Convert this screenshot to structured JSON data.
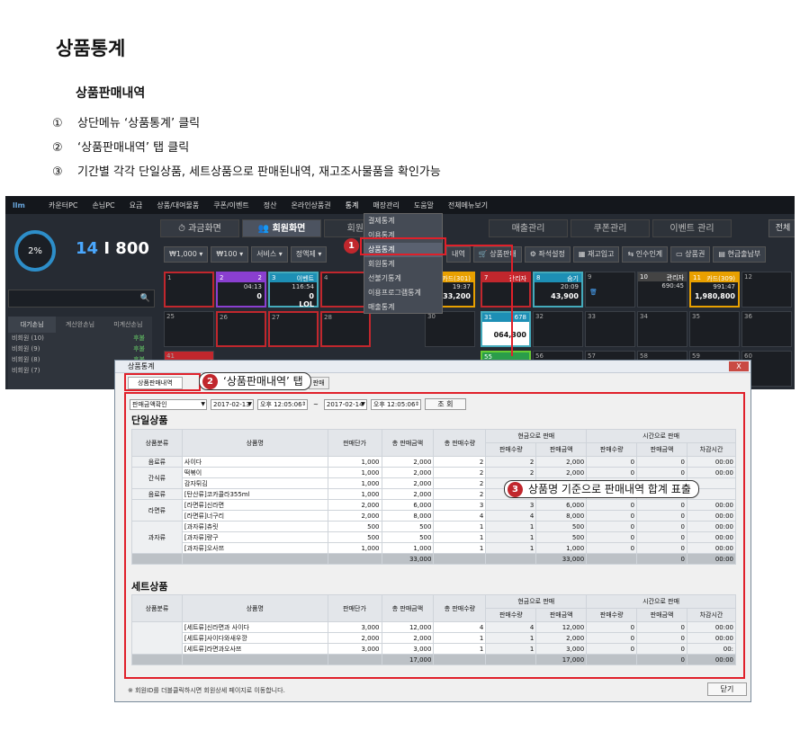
{
  "doc": {
    "title": "상품통계",
    "subtitle": "상품판매내역",
    "steps": [
      {
        "num": "①",
        "text": "상단메뉴 ‘상품통계’ 클릭"
      },
      {
        "num": "②",
        "text": "‘상품판매내역’ 탭 클릭"
      },
      {
        "num": "③",
        "text": "기간별 각각 단일상품, 세트상품으로 판매된내역, 재고조사물품을 확인가능"
      }
    ]
  },
  "app": {
    "logo": "llm",
    "menu": [
      "카운터PC",
      "손님PC",
      "요금",
      "상품/대여물품",
      "쿠폰/이벤트",
      "정산",
      "온라인상품권",
      "통계",
      "매장관리",
      "도움말",
      "전체메뉴보기"
    ],
    "gauge": "2%",
    "count_a": "14",
    "count_sep": " I ",
    "count_b": "800",
    "tabs": [
      "과금화면",
      "회원화면",
      "회원관리",
      "매출관리",
      "쿠폰관리",
      "이벤트 관리"
    ],
    "corner_label": "전체",
    "buttons_left": [
      "₩1,000",
      "₩100",
      "서비스",
      "정액제"
    ],
    "buttons_right": [
      "내역",
      "상품판매",
      "좌석설정",
      "재고입고",
      "인수인계",
      "상품권",
      "현금출납부"
    ],
    "wait_tabs": [
      "대기손님",
      "계산완손님",
      "미계산손님"
    ],
    "wait_rows": [
      {
        "name": "비회원 (10)",
        "state": "후불"
      },
      {
        "name": "비회원 (9)",
        "state": "후불"
      },
      {
        "name": "비회원 (8)",
        "state": "후불"
      },
      {
        "name": "비회원 (7)",
        "state": "후불"
      }
    ],
    "dropdown": [
      "결제통계",
      "이용통계",
      "상품통계",
      "회원통계",
      "선불기통계",
      "이용프로그램통계",
      "매출통계"
    ],
    "seats_row1": [
      {
        "no": "1",
        "name": "",
        "time": "",
        "amt": ""
      },
      {
        "no": "2",
        "name": "2",
        "time": "04:13",
        "amt": "0"
      },
      {
        "no": "3",
        "name": "이벤트",
        "time": "116:54",
        "amt": "0"
      },
      {
        "no": "4",
        "name": "",
        "time": "",
        "amt": ""
      },
      {
        "no": "6",
        "name": "카드(301)",
        "time": "19:37",
        "amt": "33,200"
      },
      {
        "no": "7",
        "name": "관리자",
        "time": "",
        "amt": ""
      },
      {
        "no": "8",
        "name": "숨기",
        "time": "20:09",
        "amt": "43,900"
      },
      {
        "no": "9",
        "name": "",
        "time": "",
        "amt": ""
      },
      {
        "no": "10",
        "name": "관리자",
        "time": "690:45",
        "amt": ""
      },
      {
        "no": "11",
        "name": "카드(309)",
        "time": "991:47",
        "amt": "1,980,800"
      },
      {
        "no": "12",
        "name": "",
        "time": "",
        "amt": ""
      }
    ],
    "seat3_extra": "LOL",
    "seats_row2": [
      "25",
      "26",
      "27",
      "28",
      "30",
      "31",
      "32",
      "33",
      "34",
      "35",
      "36"
    ],
    "seat31_amt": "064,300",
    "seat31_name": "678",
    "seats_row3": [
      "41",
      "55",
      "56",
      "57",
      "58",
      "59",
      "60"
    ]
  },
  "dialog": {
    "title": "상품통계",
    "tab_active": "상품판매내역",
    "tab_other": "판매",
    "close_x": "X",
    "filter": {
      "type": "판매금액확인",
      "date_from": "2017-02-13",
      "time_from": "오후 12:05:06",
      "tilde": "~",
      "date_to": "2017-02-14",
      "time_to": "오후 12:05:06",
      "query": "조  회"
    },
    "single": {
      "title": "단일상품",
      "headers": [
        "상품분류",
        "상품명",
        "판매단가",
        "총 판매금액",
        "총 판매수량",
        "현금으로 판매",
        "시간으로 판매"
      ],
      "subheaders": [
        "판매수량",
        "판매금액",
        "판매수량",
        "판매금액",
        "차감시간"
      ],
      "rows": [
        {
          "cat": "음료류",
          "name": "사이다",
          "price": "1,000",
          "total": "2,000",
          "qty": "2",
          "cq": "2",
          "ca": "2,000",
          "tq": "0",
          "ta": "0",
          "tt": "00:00"
        },
        {
          "cat": "간식류",
          "name": "떡볶이",
          "price": "1,000",
          "total": "2,000",
          "qty": "2",
          "cq": "2",
          "ca": "2,000",
          "tq": "0",
          "ta": "0",
          "tt": "00:00"
        },
        {
          "cat": "",
          "name": "감자튀김",
          "price": "1,000",
          "total": "2,000",
          "qty": "2",
          "cq": "",
          "ca": "",
          "tq": "",
          "ta": "",
          "tt": ""
        },
        {
          "cat": "음료류",
          "name": "[탄산류]코카콜라355ml",
          "price": "1,000",
          "total": "2,000",
          "qty": "2",
          "cq": "",
          "ca": "",
          "tq": "",
          "ta": "",
          "tt": ""
        },
        {
          "cat": "라면류",
          "name": "[라면류]신라면",
          "price": "2,000",
          "total": "6,000",
          "qty": "3",
          "cq": "3",
          "ca": "6,000",
          "tq": "0",
          "ta": "0",
          "tt": "00:00"
        },
        {
          "cat": "",
          "name": "[라면류]너구리",
          "price": "2,000",
          "total": "8,000",
          "qty": "4",
          "cq": "4",
          "ca": "8,000",
          "tq": "0",
          "ta": "0",
          "tt": "00:00"
        },
        {
          "cat": "과자류",
          "name": "[과자류]츄릿",
          "price": "500",
          "total": "500",
          "qty": "1",
          "cq": "1",
          "ca": "500",
          "tq": "0",
          "ta": "0",
          "tt": "00:00"
        },
        {
          "cat": "",
          "name": "[과자류]량구",
          "price": "500",
          "total": "500",
          "qty": "1",
          "cq": "1",
          "ca": "500",
          "tq": "0",
          "ta": "0",
          "tt": "00:00"
        },
        {
          "cat": "",
          "name": "[과자류]오사쯔",
          "price": "1,000",
          "total": "1,000",
          "qty": "1",
          "cq": "1",
          "ca": "1,000",
          "tq": "0",
          "ta": "0",
          "tt": "00:00"
        }
      ],
      "sum": {
        "total": "33,000",
        "ca": "33,000",
        "ta": "0",
        "tt": "00:00"
      }
    },
    "set": {
      "title": "세트상품",
      "rows": [
        {
          "cat": "",
          "name": "[세트류]신라면과 사이다",
          "price": "3,000",
          "total": "12,000",
          "qty": "4",
          "cq": "4",
          "ca": "12,000",
          "tq": "0",
          "ta": "0",
          "tt": "00:00"
        },
        {
          "cat": "기타상품",
          "name": "[세트류]사이다와새우깡",
          "price": "2,000",
          "total": "2,000",
          "qty": "1",
          "cq": "1",
          "ca": "2,000",
          "tq": "0",
          "ta": "0",
          "tt": "00:00"
        },
        {
          "cat": "",
          "name": "[세트류]라면과오사쯔",
          "price": "3,000",
          "total": "3,000",
          "qty": "1",
          "cq": "1",
          "ca": "3,000",
          "tq": "0",
          "ta": "0",
          "tt": "00:"
        }
      ],
      "sum": {
        "total": "17,000",
        "ca": "17,000",
        "ta": "0",
        "tt": "00:00"
      }
    },
    "footer_note": "※ 회원ID를 더블클릭하시면 회원상세 페이지로 이동합니다.",
    "close_label": "닫기"
  },
  "callouts": {
    "c1": "1",
    "c2": "2",
    "c2_text": "‘상품판매내역’ 탭",
    "c3": "3",
    "c3_text": "상품명 기준으로 판매내역 합계 표출"
  }
}
